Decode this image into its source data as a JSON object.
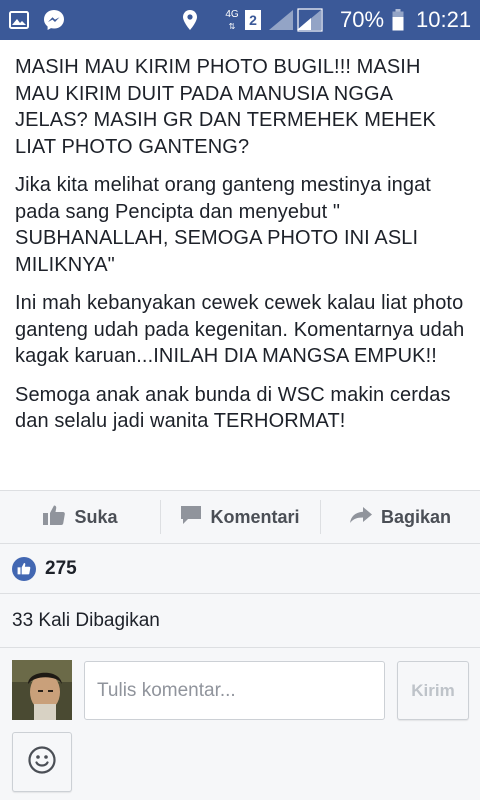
{
  "status_bar": {
    "network_type": "4G",
    "sim_slot": "2",
    "battery_percent": "70%",
    "time": "10:21",
    "icons": [
      "gallery-icon",
      "messenger-icon",
      "location-icon",
      "network-4g-icon",
      "signal-icon",
      "battery-icon"
    ]
  },
  "post": {
    "paragraphs": [
      "MASIH MAU KIRIM PHOTO BUGIL!!! MASIH MAU KIRIM DUIT PADA MANUSIA NGGA JELAS? MASIH GR DAN TERMEHEK MEHEK LIAT PHOTO GANTENG?",
      "Jika kita melihat orang ganteng mestinya ingat pada sang Pencipta dan menyebut \" SUBHANALLAH, SEMOGA PHOTO INI ASLI MILIKNYA\"",
      "Ini mah kebanyakan cewek cewek kalau liat photo ganteng udah pada kegenitan. Komentarnya udah kagak karuan...INILAH DIA MANGSA EMPUK!!",
      "Semoga anak anak bunda di WSC makin cerdas dan selalu jadi wanita TERHORMAT!"
    ]
  },
  "actions": {
    "like_label": "Suka",
    "comment_label": "Komentari",
    "share_label": "Bagikan"
  },
  "reactions": {
    "like_count": "275"
  },
  "shares": {
    "label": "33 Kali Dibagikan"
  },
  "composer": {
    "placeholder": "Tulis komentar...",
    "send_label": "Kirim"
  },
  "colors": {
    "status_bar": "#3b5998",
    "like_badge": "#4267b2",
    "text": "#1d2129",
    "muted": "#4b4f56",
    "background": "#f6f7f9"
  }
}
